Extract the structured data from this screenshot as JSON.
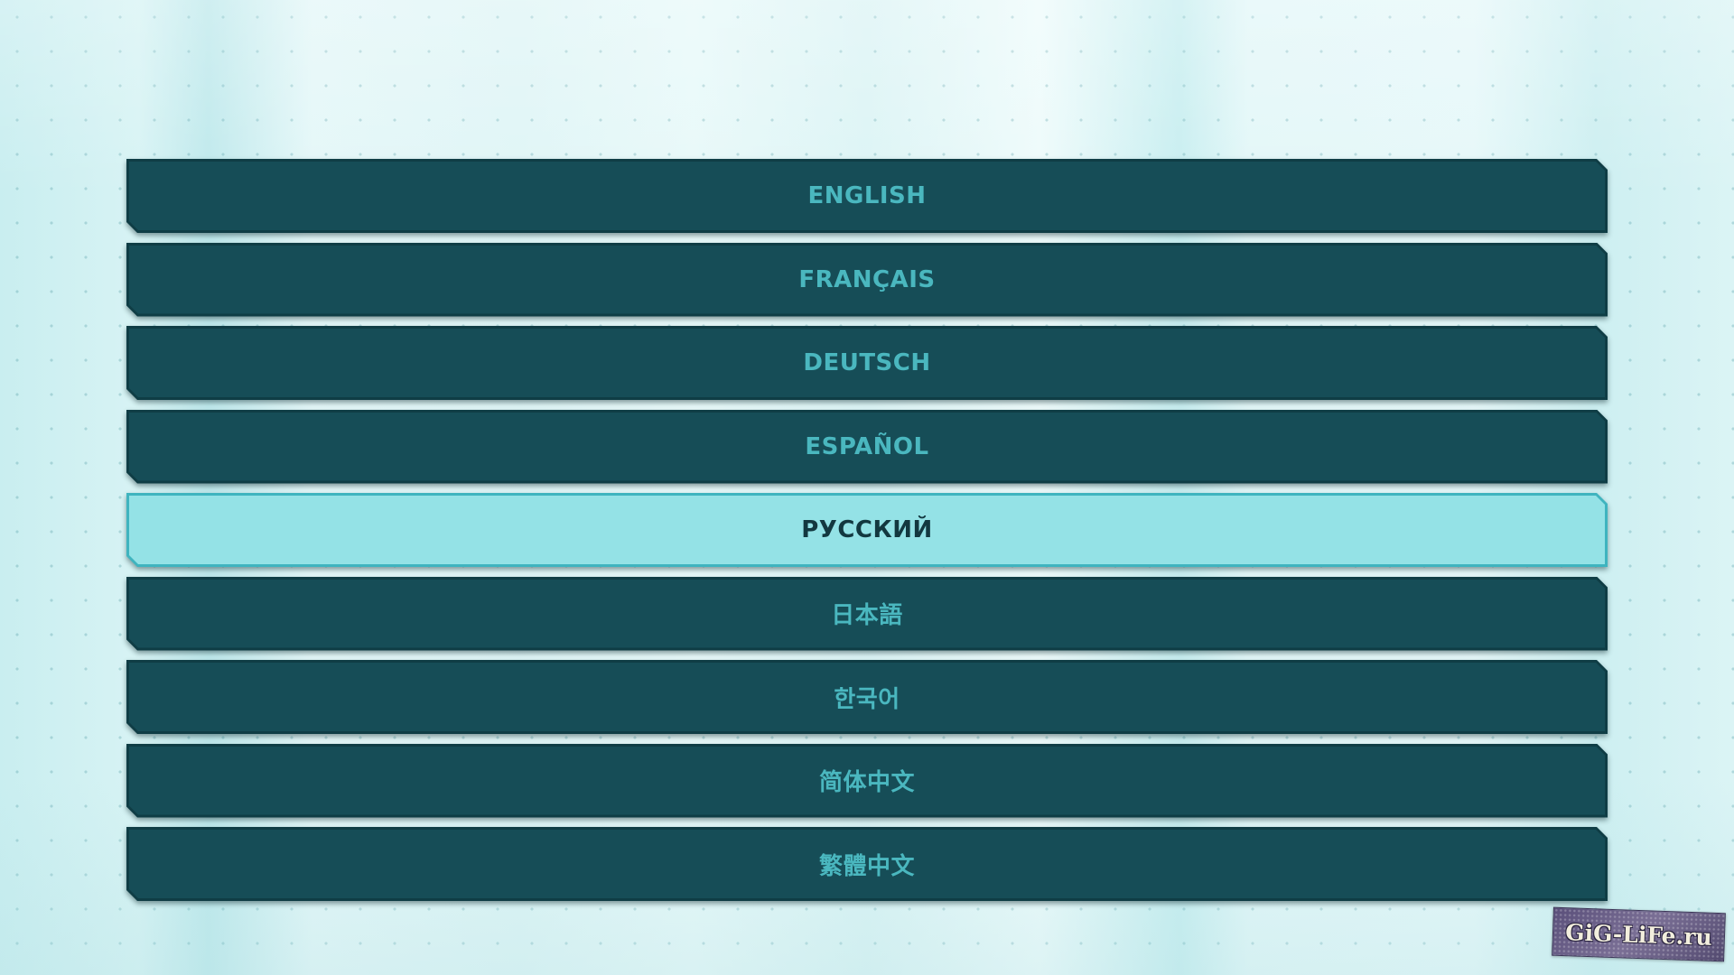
{
  "language_menu": {
    "selected_index": 4,
    "items": [
      {
        "label": "ENGLISH"
      },
      {
        "label": "FRANÇAIS"
      },
      {
        "label": "DEUTSCH"
      },
      {
        "label": "ESPAÑOL"
      },
      {
        "label": "РУССКИЙ"
      },
      {
        "label": "日本語"
      },
      {
        "label": "한국어"
      },
      {
        "label": "简体中文"
      },
      {
        "label": "繁體中文"
      }
    ]
  },
  "watermark": {
    "text": "GiG-LiFe.ru"
  },
  "colors": {
    "button_face": "#164d57",
    "button_text": "#4ab7bf",
    "selected_face": "#94e2e6",
    "selected_text": "#133840",
    "background": "#dff5f6"
  }
}
